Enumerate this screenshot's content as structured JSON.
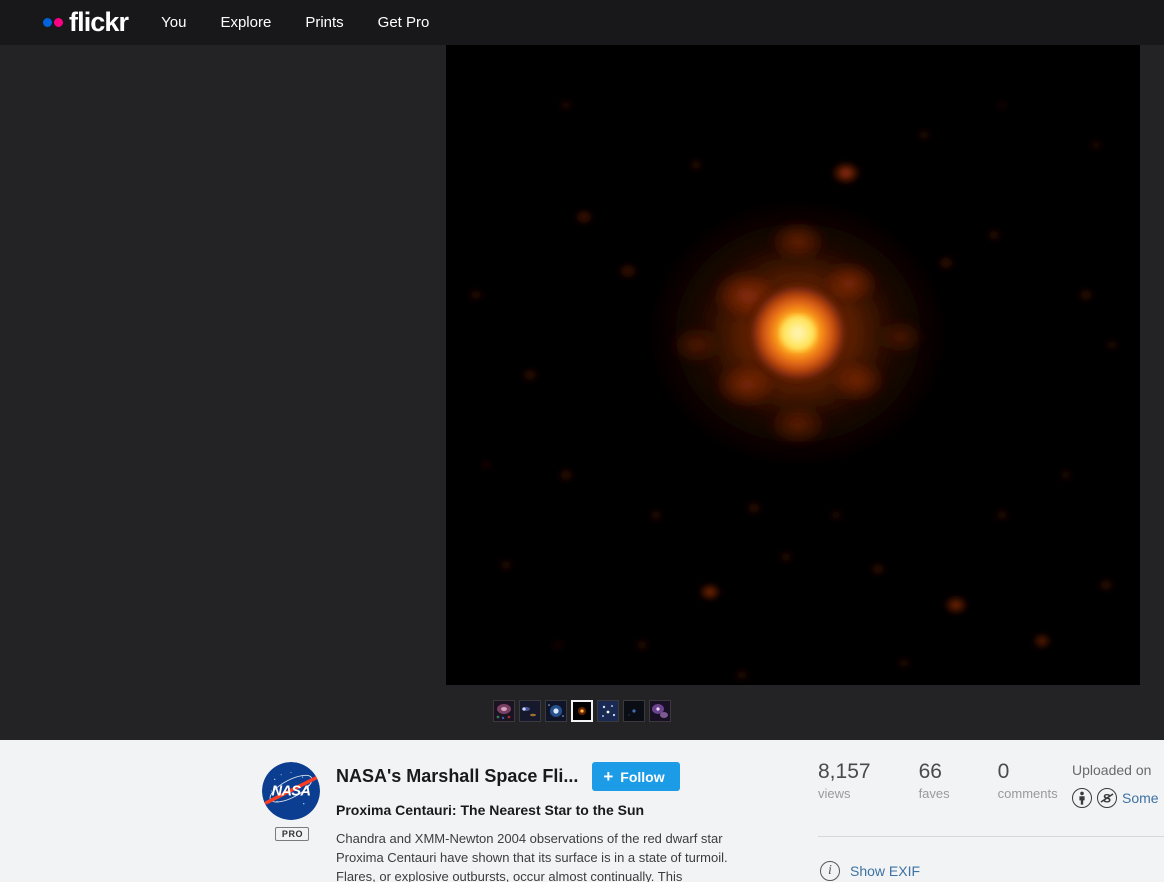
{
  "header": {
    "logo_text": "flickr",
    "logo_dot_blue": "#0063dc",
    "logo_dot_pink": "#ff0084",
    "nav": [
      {
        "label": "You"
      },
      {
        "label": "Explore"
      },
      {
        "label": "Prints"
      },
      {
        "label": "Get Pro"
      }
    ]
  },
  "photo": {
    "alt_description": "X-ray image of Proxima Centauri: a bright yellow-orange point source with a diffuse orange halo on a black field scattered with faint red background specks",
    "background_color": "#000000",
    "stage_background": "#232325",
    "core_color": "#ffe060",
    "halo_color": "#e8641a",
    "speck_color": "#8a1f06"
  },
  "filmstrip": {
    "selected_index": 3,
    "thumbnails": [
      {
        "name": "thumb-nebula-ring",
        "tint": "#6b3a52"
      },
      {
        "name": "thumb-comet-streak",
        "tint": "#2a2f55"
      },
      {
        "name": "thumb-blue-galaxy",
        "tint": "#2d4f86"
      },
      {
        "name": "thumb-proxima-centauri",
        "tint": "#3a1405"
      },
      {
        "name": "thumb-star-field",
        "tint": "#2b3f74"
      },
      {
        "name": "thumb-dark-field",
        "tint": "#14161f"
      },
      {
        "name": "thumb-purple-nebula",
        "tint": "#6a4a82"
      }
    ]
  },
  "owner": {
    "name": "NASA's Marshall Space Fli...",
    "pro_badge": "PRO",
    "avatar_alt": "NASA insignia",
    "follow_label": "Follow",
    "follow_plus": "+",
    "follow_color": "#1c9be6"
  },
  "post": {
    "title": "Proxima Centauri: The Nearest Star to the Sun",
    "description": "Chandra and XMM-Newton 2004 observations of the red dwarf star Proxima Centauri have shown that its surface is in a state of turmoil. Flares, or explosive outbursts, occur almost continually. This"
  },
  "stats": [
    {
      "value": "8,157",
      "label": "views"
    },
    {
      "value": "66",
      "label": "faves"
    },
    {
      "value": "0",
      "label": "comments"
    }
  ],
  "meta": {
    "uploaded_text": "Uploaded on",
    "license_text": "Some",
    "license_icons": [
      "attribution-icon",
      "noncommercial-icon"
    ],
    "exif_label": "Show EXIF",
    "link_color": "#3d72a4"
  }
}
